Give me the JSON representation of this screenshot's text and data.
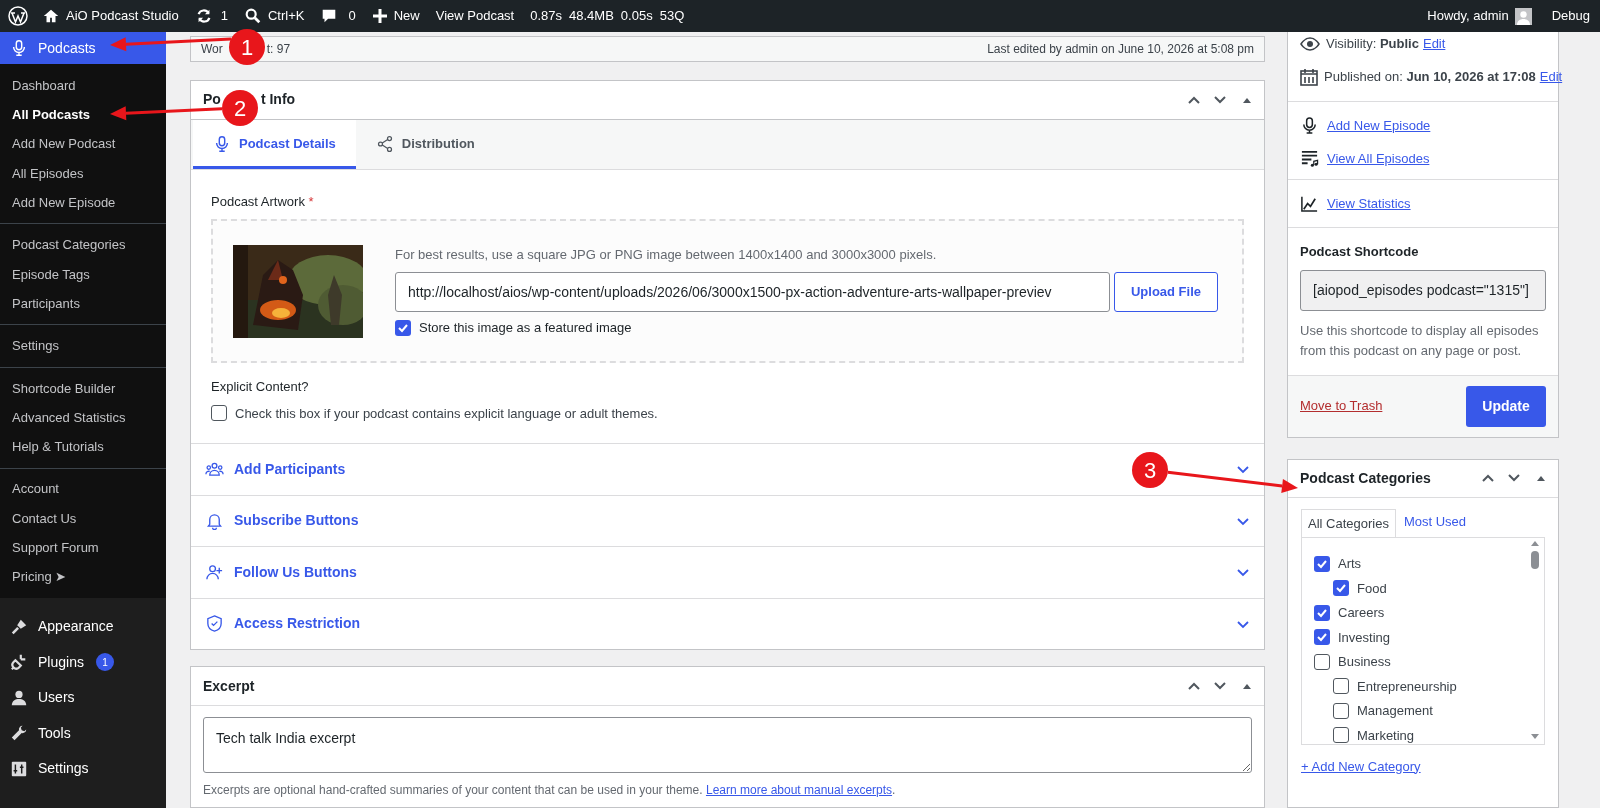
{
  "admin_bar": {
    "site": "AiO Podcast Studio",
    "updates": "1",
    "search": "Ctrl+K",
    "comments": "0",
    "new": "New",
    "view": "View Podcast",
    "stats": [
      "0.87s",
      "48.4MB",
      "0.05s",
      "53Q"
    ],
    "greeting": "Howdy, admin",
    "debug": "Debug"
  },
  "sidebar": {
    "current": {
      "label": "Podcasts",
      "selected": true
    },
    "submenu_groups": [
      [
        {
          "label": "Dashboard",
          "selected": false
        },
        {
          "label": "All Podcasts",
          "selected": true
        },
        {
          "label": "Add New Podcast",
          "selected": false
        },
        {
          "label": "All Episodes",
          "selected": false
        },
        {
          "label": "Add New Episode",
          "selected": false
        }
      ],
      [
        {
          "label": "Podcast Categories",
          "selected": false
        },
        {
          "label": "Episode Tags",
          "selected": false
        },
        {
          "label": "Participants",
          "selected": false
        }
      ],
      [
        {
          "label": "Settings",
          "selected": false
        }
      ],
      [
        {
          "label": "Shortcode Builder",
          "selected": false
        },
        {
          "label": "Advanced Statistics",
          "selected": false
        },
        {
          "label": "Help & Tutorials",
          "selected": false
        }
      ],
      [
        {
          "label": "Account",
          "selected": false
        },
        {
          "label": "Contact Us",
          "selected": false
        },
        {
          "label": "Support Forum",
          "selected": false
        },
        {
          "label": "Pricing ➤",
          "selected": false
        }
      ]
    ],
    "menu": [
      {
        "label": "Appearance",
        "kind": "brush"
      },
      {
        "label": "Plugins",
        "kind": "plug",
        "badge": "1"
      },
      {
        "label": "Users",
        "kind": "user"
      },
      {
        "label": "Tools",
        "kind": "wrench"
      },
      {
        "label": "Settings",
        "kind": "sliders"
      }
    ]
  },
  "word_count_parts": [
    "Wor",
    "t: 97"
  ],
  "last_edited": "Last edited by admin on June 10, 2026 at 5:08 pm",
  "podcast_info": {
    "title_parts": [
      "Po",
      "t Info"
    ],
    "tabs": [
      {
        "label": "Podcast Details",
        "kind": "mic",
        "selected": true
      },
      {
        "label": "Distribution",
        "kind": "share",
        "selected": false
      }
    ],
    "artwork_label": "Podcast Artwork",
    "required_mark": "*",
    "artwork_hint": "For best results, use a square JPG or PNG image between 1400x1400 and 3000x3000 pixels.",
    "artwork_url": "http://localhost/aios/wp-content/uploads/2026/06/3000x1500-px-action-adventure-arts-wallpaper-previev",
    "upload_button": "Upload File",
    "featured": {
      "label": "Store this image as a featured image",
      "checked": true
    },
    "explicit_label": "Explicit Content?",
    "explicit": {
      "label": "Check this box if your podcast contains explicit language or adult themes.",
      "checked": false
    },
    "sections": [
      {
        "label": "Add Participants",
        "kind": "people"
      },
      {
        "label": "Subscribe Buttons",
        "kind": "bell"
      },
      {
        "label": "Follow Us Buttons",
        "kind": "user-plus"
      },
      {
        "label": "Access Restriction",
        "kind": "shield"
      }
    ]
  },
  "excerpt": {
    "title": "Excerpt",
    "value": "Tech talk India excerpt",
    "help": "Excerpts are optional hand-crafted summaries of your content that can be used in your theme.",
    "link": "Learn more about manual excerpts",
    "trail": "."
  },
  "publish": {
    "visibility": "Visibility: **Public**",
    "visibility_link": "Edit",
    "published": "Published on: **Jun 10, 2026 at 17:08**",
    "published_link": "Edit",
    "links": [
      {
        "label": "Add New Episode",
        "kind": "mic"
      },
      {
        "label": "View All Episodes",
        "kind": "list"
      },
      {
        "label": "View Statistics",
        "kind": "chart"
      }
    ],
    "shortcode_label": "Podcast Shortcode",
    "shortcode": "[aiopod_episodes podcast=\"1315\"]",
    "shortcode_help": "Use this shortcode to display all episodes from this podcast on any page or post.",
    "trash": "Move to Trash",
    "update": "Update"
  },
  "categories": {
    "title": "Podcast Categories",
    "tabs": [
      {
        "label": "All Categories",
        "selected": true
      },
      {
        "label": "Most Used",
        "selected": false
      }
    ],
    "items": [
      {
        "label": "Arts",
        "checked": true,
        "children": [
          {
            "label": "Food",
            "checked": true
          }
        ]
      },
      {
        "label": "Careers",
        "checked": true
      },
      {
        "label": "Investing",
        "checked": true
      },
      {
        "label": "Business",
        "checked": false,
        "children": [
          {
            "label": "Entrepreneurship",
            "checked": false
          },
          {
            "label": "Management",
            "checked": false
          },
          {
            "label": "Marketing",
            "checked": false
          }
        ]
      }
    ],
    "add_link": "+ Add New Category"
  },
  "annotations": [
    {
      "number": "1"
    },
    {
      "number": "2"
    },
    {
      "number": "3"
    }
  ]
}
